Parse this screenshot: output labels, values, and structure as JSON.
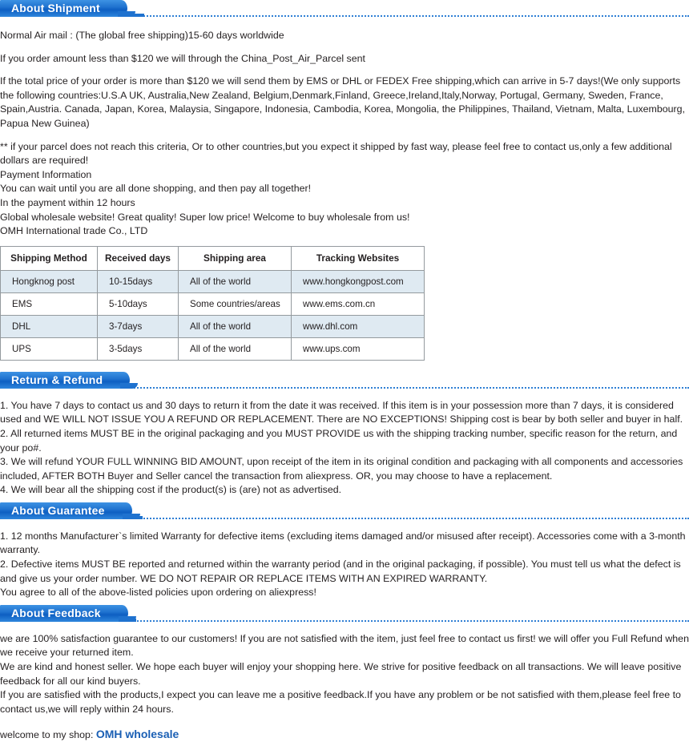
{
  "colors": {
    "banner_blue": "#1f72cf",
    "dotted_rule": "#2f7fd4",
    "table_alt_row": "#dfeaf2",
    "table_border": "#949a9e",
    "link_blue": "#1a5fb4"
  },
  "sections": {
    "shipment": {
      "title": "About Shipment",
      "paragraphs": [
        "Normal Air mail : (The global free shipping)15-60 days worldwide",
        "If you order amount less than $120 we will through the China_Post_Air_Parcel sent",
        "If the total price of your order is more than $120 we will send them by EMS or DHL or FEDEX Free shipping,which can arrive in 5-7 days!(We only supports the following countries:U.S.A UK, Australia,New Zealand, Belgium,Denmark,Finland, Greece,Ireland,Italy,Norway, Portugal, Germany, Sweden, France, Spain,Austria. Canada, Japan, Korea, Malaysia, Singapore, Indonesia, Cambodia, Korea, Mongolia, the Philippines, Thailand, Vietnam, Malta, Luxembourg, Papua New Guinea)",
        "** if your parcel does not reach this criteria, Or to other countries,but you expect it shipped by fast way, please feel free to contact us,only a few additional dollars are required!",
        "Payment Information",
        "You can wait until you are all done shopping, and then pay all together!",
        "In the payment within 12 hours",
        "Global wholesale website! Great quality! Super low price! Welcome to buy wholesale from us!",
        "OMH International trade Co., LTD"
      ]
    },
    "return_refund": {
      "title": "Return & Refund",
      "paragraphs": [
        "1. You have 7 days to contact us and 30 days to return it from the date it was received. If this item is in your possession more than 7 days, it is considered used and WE WILL NOT ISSUE YOU A REFUND OR REPLACEMENT. There are NO EXCEPTIONS! Shipping cost is bear by both seller and buyer in half.",
        "2. All returned items MUST BE in the original packaging and you MUST PROVIDE us with the shipping tracking number, specific reason for the return, and your po#.",
        "3. We will refund YOUR FULL WINNING BID AMOUNT, upon receipt of the item in its original condition and packaging with all components and accessories included, AFTER BOTH Buyer and Seller cancel the transaction from aliexpress. OR, you may choose to have a replacement.",
        "4. We will bear all the shipping cost if the product(s) is (are) not as advertised."
      ]
    },
    "guarantee": {
      "title": "About Guarantee",
      "paragraphs": [
        "1. 12 months Manufacturer`s limited Warranty for defective items (excluding items damaged and/or misused after receipt). Accessories come with a 3-month warranty.",
        "2. Defective items MUST BE reported and returned within the warranty period (and in the original packaging, if possible). You must tell us what the defect is and give us your order number. WE DO NOT REPAIR OR REPLACE ITEMS WITH AN EXPIRED WARRANTY.",
        "You agree to all of the above-listed policies upon ordering on aliexpress!"
      ]
    },
    "feedback": {
      "title": "About Feedback",
      "paragraphs": [
        "we are 100% satisfaction guarantee to our customers! If you are not satisfied with the item, just feel free to contact us first! we will offer you Full Refund when we receive your returned item.",
        "We are kind and honest seller. We hope each buyer will enjoy your shopping here. We strive for positive feedback on all transactions. We will leave positive feedback for all our kind buyers.",
        "If you are satisfied with the products,I expect you can leave me a positive feedback.If you have any problem or be not satisfied with them,please feel free to contact us,we will reply within 24 hours."
      ],
      "shop_prefix": "welcome to my shop: ",
      "shop_name": "OMH wholesale"
    }
  },
  "shipping_table": {
    "headers": [
      "Shipping Method",
      "Received days",
      "Shipping area",
      "Tracking Websites"
    ],
    "rows": [
      [
        "Hongknog post",
        "10-15days",
        "All of the world",
        "www.hongkongpost.com"
      ],
      [
        "EMS",
        "5-10days",
        "Some countries/areas",
        "www.ems.com.cn"
      ],
      [
        "DHL",
        "3-7days",
        "All of the world",
        "www.dhl.com"
      ],
      [
        "UPS",
        "3-5days",
        "All of the world",
        "www.ups.com"
      ]
    ]
  }
}
